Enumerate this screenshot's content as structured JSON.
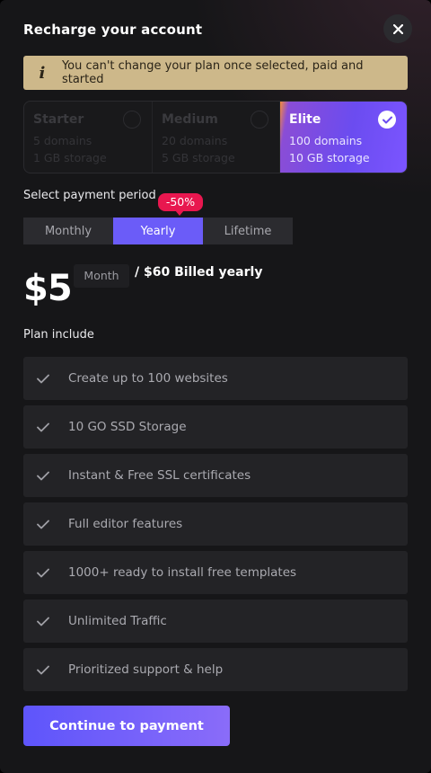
{
  "header": {
    "title": "Recharge your account",
    "close_icon": "close-icon"
  },
  "warning": {
    "icon": "info-icon",
    "text": "You can't change your plan once selected, paid and started",
    "color": "#cdb88a"
  },
  "plans": [
    {
      "name": "Starter",
      "domains": "5 domains",
      "storage": "1 GB storage",
      "selected": false
    },
    {
      "name": "Medium",
      "domains": "20 domains",
      "storage": "5 GB storage",
      "selected": false
    },
    {
      "name": "Elite",
      "domains": "100 domains",
      "storage": "10 GB storage",
      "selected": true
    }
  ],
  "payment": {
    "label": "Select payment period",
    "discount_badge": "-50%",
    "periods": [
      "Monthly",
      "Yearly",
      "Lifetime"
    ],
    "selected_period": "Yearly",
    "price": "$5",
    "unit": "Month",
    "billed": "/ $60 Billed yearly"
  },
  "include": {
    "label": "Plan include",
    "features": [
      "Create up to 100 websites",
      "10 GO SSD Storage",
      "Instant & Free SSL certificates",
      "Full editor features",
      "1000+ ready to install free templates",
      "Unlimited Traffic",
      "Prioritized support & help"
    ]
  },
  "cta": {
    "label": "Continue to payment"
  },
  "colors": {
    "accent": "#6b5cf8",
    "discount": "#e8174f",
    "background": "#161618"
  }
}
